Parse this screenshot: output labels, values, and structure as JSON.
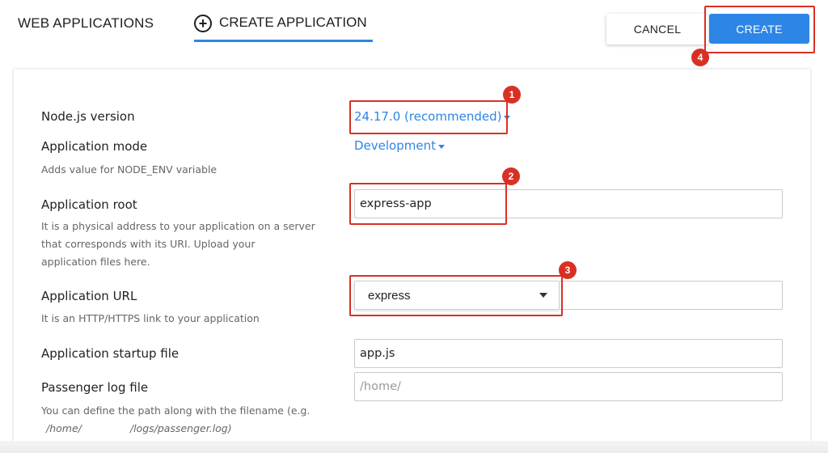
{
  "header": {
    "tab_web": "WEB APPLICATIONS",
    "tab_create": "CREATE APPLICATION",
    "cancel_label": "CANCEL",
    "create_label": "CREATE",
    "create_icon": "plus-circle-icon"
  },
  "form": {
    "node_version": {
      "label": "Node.js version",
      "value": "24.17.0 (recommended)"
    },
    "app_mode": {
      "label": "Application mode",
      "value": "Development",
      "hint": "Adds value for NODE_ENV variable"
    },
    "app_root": {
      "label": "Application root",
      "value": "express-app",
      "hint_lines": [
        "It is a physical address to your application on a server",
        "that corresponds with its URI. Upload your",
        "application files here."
      ]
    },
    "app_url": {
      "label": "Application URL",
      "domain_value": "express",
      "hint": "It is an HTTP/HTTPS link to your application"
    },
    "startup_file": {
      "label": "Application startup file",
      "value": "app.js"
    },
    "log_file": {
      "label": "Passenger log file",
      "placeholder": "/home/",
      "hint_line1": "You can define the path along with the filename (e.g.",
      "hint_line2_a": "/home/",
      "hint_line2_b": "/logs/passenger.log)"
    }
  },
  "annotations": [
    "1",
    "2",
    "3",
    "4"
  ],
  "colors": {
    "accent": "#2d86e6",
    "annotation": "#d93025"
  }
}
